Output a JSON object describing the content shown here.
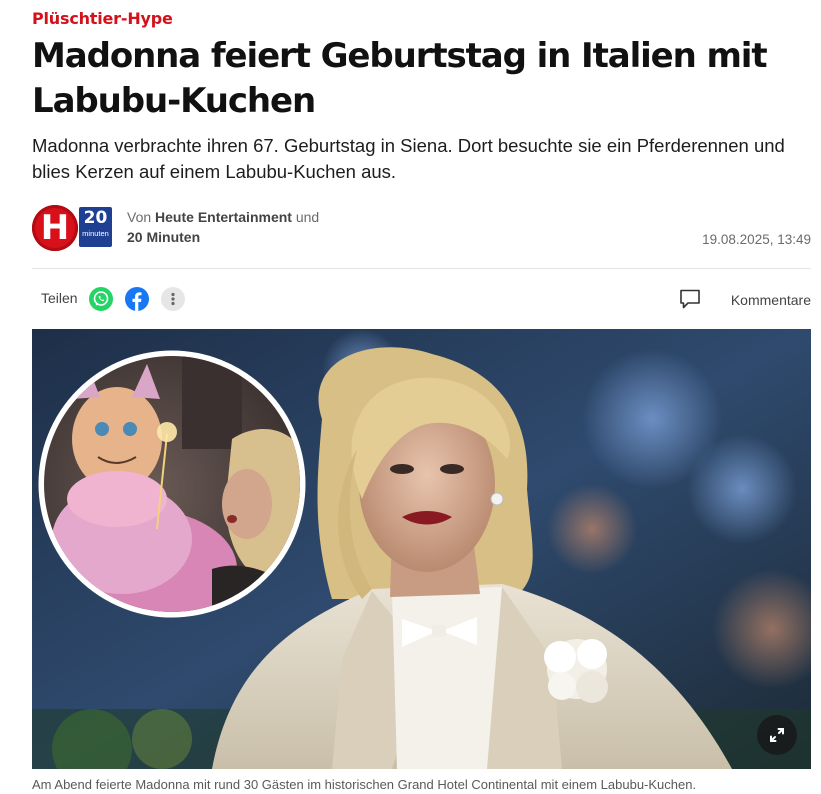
{
  "article": {
    "kicker": "Plüschtier-Hype",
    "headline": "Madonna feiert Geburtstag in Italien mit Labubu-Kuchen",
    "lead": "Madonna verbrachte ihren 67. Geburtstag in Siena. Dort besuchte sie ein Pferderennen und blies Kerzen auf einem Labubu-Kuchen aus.",
    "byline": {
      "prefix": "Von",
      "author1": "Heute Entertainment",
      "and": "und",
      "author2": "20 Minuten"
    },
    "date": "19.08.2025, 13:49",
    "caption": "Am Abend feierte Madonna mit rund 30 Gästen im historischen Grand Hotel Continental mit einem Labubu-Kuchen."
  },
  "logos": {
    "heute_letter": "H",
    "twenty_number": "20",
    "twenty_text": "minuten"
  },
  "share": {
    "label": "Teilen",
    "buttons": [
      "whatsapp-icon",
      "facebook-icon",
      "more-icon"
    ],
    "comments_label": "Kommentare"
  },
  "colors": {
    "brand_red": "#d4111b",
    "whatsapp": "#25d366",
    "facebook": "#1877f2",
    "twenty_blue": "#1f3f93"
  }
}
